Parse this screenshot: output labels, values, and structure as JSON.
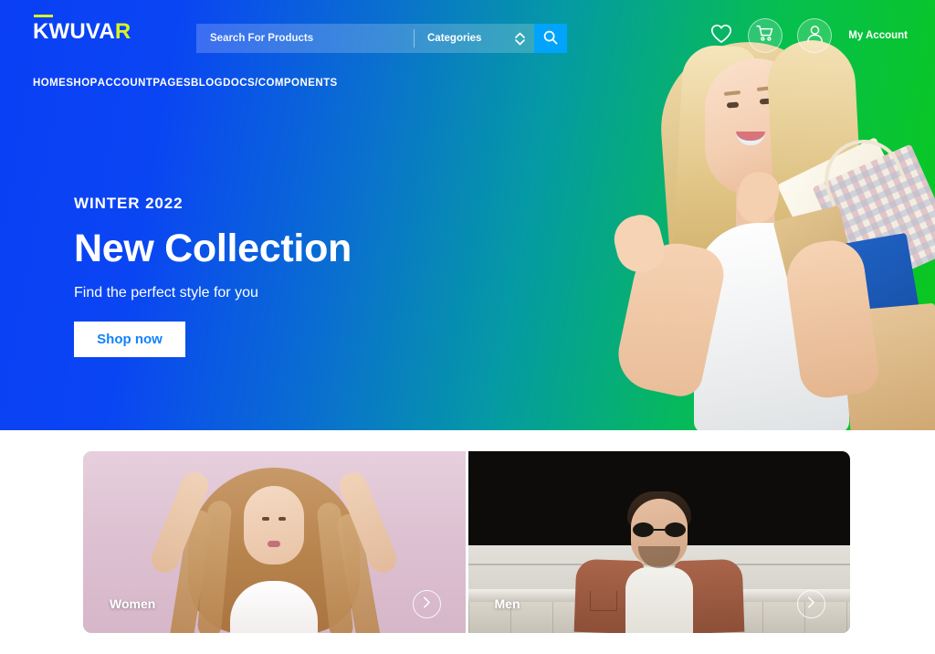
{
  "brand": {
    "name_main": "KWUVA",
    "name_accent": "R"
  },
  "search": {
    "placeholder": "Search For Products",
    "value": "",
    "categories_label": "Categories",
    "search_icon": "search-icon",
    "chevron_icon": "chevron-up-down-icon",
    "button_color": "#01a4fa"
  },
  "header_actions": {
    "wishlist_icon": "heart-icon",
    "cart_icon": "shopping-cart-icon",
    "account_icon": "user-icon",
    "account_label": "My Account"
  },
  "nav": {
    "items": [
      {
        "label": "HOME"
      },
      {
        "label": "SHOP"
      },
      {
        "label": "ACCOUNT"
      },
      {
        "label": "PAGES"
      },
      {
        "label": "BLOG"
      },
      {
        "label": "DOCS/COMPONENTS"
      }
    ]
  },
  "hero": {
    "eyebrow": "WINTER 2022",
    "headline": "New Collection",
    "subhead": "Find the perfect style for you",
    "cta_label": "Shop now",
    "cta_text_color": "#1183fb",
    "gradient_start": "#0a3ff5",
    "gradient_end": "#0ac81c"
  },
  "categories": {
    "cards": [
      {
        "label": "Women",
        "arrow_icon": "chevron-right-icon"
      },
      {
        "label": "Men",
        "arrow_icon": "chevron-right-icon"
      }
    ]
  }
}
